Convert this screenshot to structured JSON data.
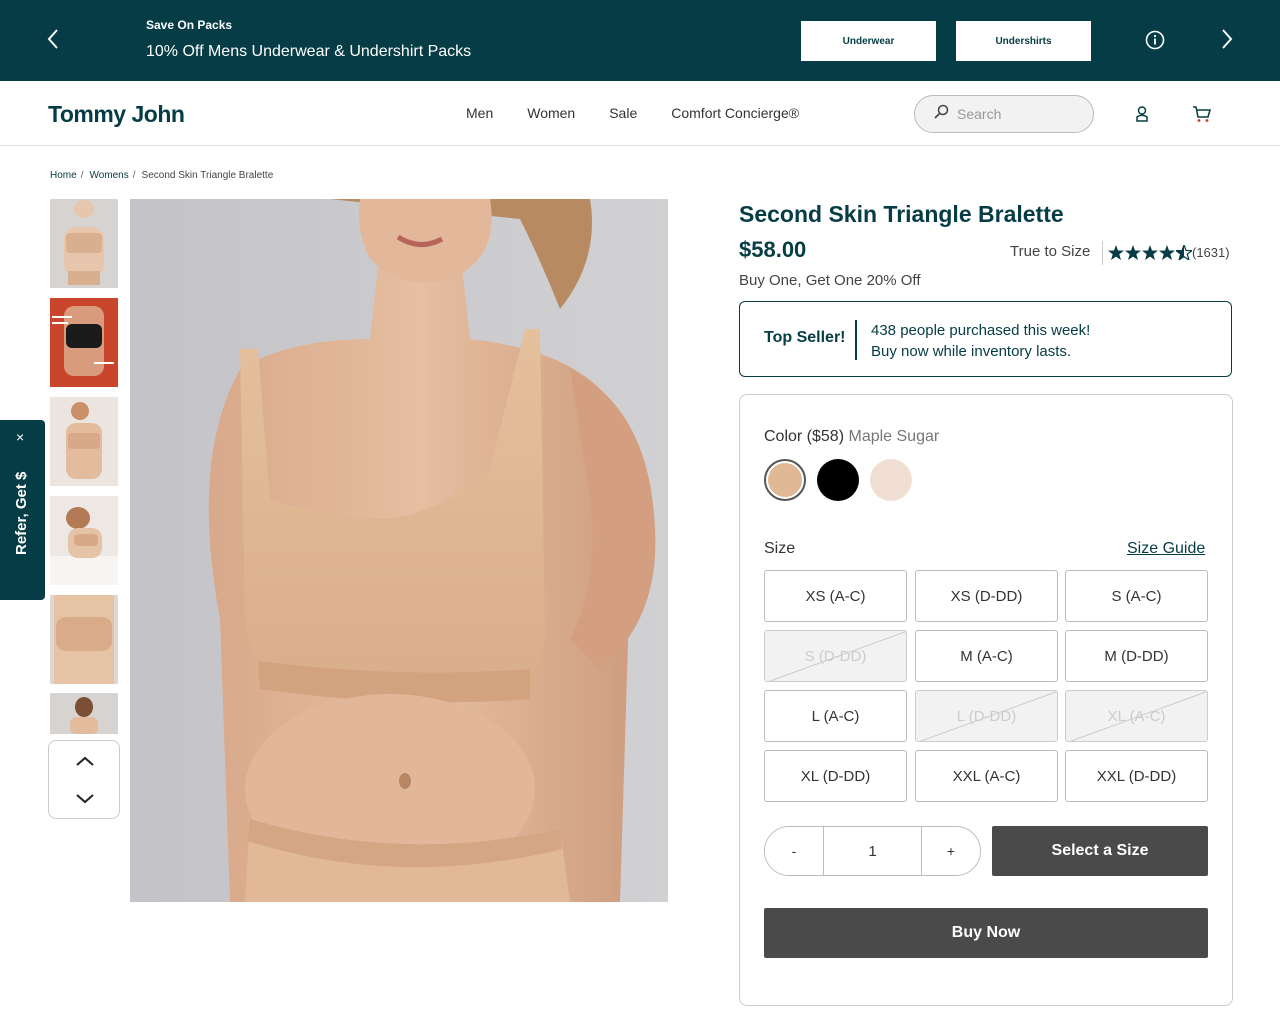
{
  "promo_banner": {
    "kicker": "Save On Packs",
    "text": "10% Off Mens Underwear & Undershirt Packs",
    "buttons": [
      "Underwear",
      "Undershirts"
    ],
    "icons": {
      "prev": "chevron-left-icon",
      "next": "chevron-right-icon",
      "info": "info-icon"
    },
    "background": "#053c45"
  },
  "header": {
    "logo": "Tommy John",
    "nav": [
      "Men",
      "Women",
      "Sale",
      "Comfort Concierge®"
    ],
    "search": {
      "placeholder": "Search"
    },
    "icons": {
      "search": "search-icon",
      "account": "user-icon",
      "cart": "cart-icon"
    }
  },
  "breadcrumb": {
    "links": [
      "Home",
      "Womens"
    ],
    "separator": "/",
    "current": "Second Skin Triangle Bralette"
  },
  "gallery": {
    "thumbnails_count": 6,
    "nav_icons": {
      "up": "chevron-up-icon",
      "down": "chevron-down-icon"
    }
  },
  "refer_tab": {
    "label": "Refer, Get $",
    "close": "×"
  },
  "product": {
    "title": "Second Skin Triangle Bralette",
    "price": "$58.00",
    "fit": "True to Size",
    "rating": 4.5,
    "review_count": "(1631)",
    "promo": "Buy One, Get One 20% Off",
    "top_seller": {
      "tag": "Top Seller!",
      "line1": "438 people purchased this week!",
      "line2": "Buy now while inventory lasts."
    }
  },
  "options": {
    "color_label": "Color ($58)",
    "color_value": "Maple Sugar",
    "swatches": [
      {
        "color": "#e0b896",
        "selected": true
      },
      {
        "color": "#000000",
        "selected": false
      },
      {
        "color": "#f1dfd5",
        "selected": false
      }
    ],
    "size_label": "Size",
    "size_guide": "Size Guide",
    "sizes": [
      {
        "label": "XS (A-C)",
        "available": true
      },
      {
        "label": "XS (D-DD)",
        "available": true
      },
      {
        "label": "S (A-C)",
        "available": true
      },
      {
        "label": "S (D-DD)",
        "available": false
      },
      {
        "label": "M (A-C)",
        "available": true
      },
      {
        "label": "M (D-DD)",
        "available": true
      },
      {
        "label": "L (A-C)",
        "available": true
      },
      {
        "label": "L (D-DD)",
        "available": false
      },
      {
        "label": "XL (A-C)",
        "available": false
      },
      {
        "label": "XL (D-DD)",
        "available": true
      },
      {
        "label": "XXL (A-C)",
        "available": true
      },
      {
        "label": "XXL (D-DD)",
        "available": true
      }
    ],
    "quantity": {
      "minus": "-",
      "value": "1",
      "plus": "+"
    },
    "select_button": "Select a Size",
    "buy_button": "Buy Now"
  }
}
